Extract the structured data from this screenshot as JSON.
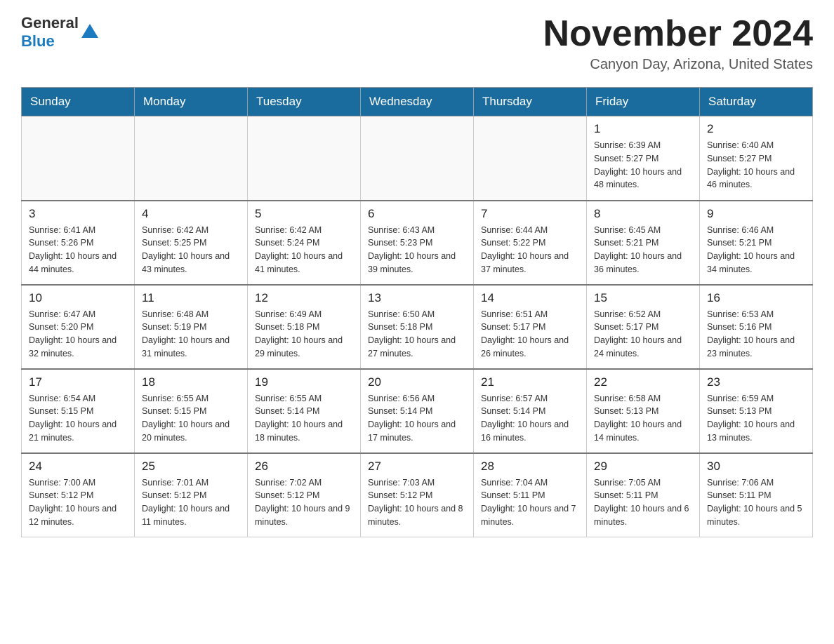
{
  "logo": {
    "text_general": "General",
    "text_blue": "Blue"
  },
  "header": {
    "title": "November 2024",
    "subtitle": "Canyon Day, Arizona, United States"
  },
  "weekdays": [
    "Sunday",
    "Monday",
    "Tuesday",
    "Wednesday",
    "Thursday",
    "Friday",
    "Saturday"
  ],
  "weeks": [
    [
      {
        "day": "",
        "info": ""
      },
      {
        "day": "",
        "info": ""
      },
      {
        "day": "",
        "info": ""
      },
      {
        "day": "",
        "info": ""
      },
      {
        "day": "",
        "info": ""
      },
      {
        "day": "1",
        "info": "Sunrise: 6:39 AM\nSunset: 5:27 PM\nDaylight: 10 hours and 48 minutes."
      },
      {
        "day": "2",
        "info": "Sunrise: 6:40 AM\nSunset: 5:27 PM\nDaylight: 10 hours and 46 minutes."
      }
    ],
    [
      {
        "day": "3",
        "info": "Sunrise: 6:41 AM\nSunset: 5:26 PM\nDaylight: 10 hours and 44 minutes."
      },
      {
        "day": "4",
        "info": "Sunrise: 6:42 AM\nSunset: 5:25 PM\nDaylight: 10 hours and 43 minutes."
      },
      {
        "day": "5",
        "info": "Sunrise: 6:42 AM\nSunset: 5:24 PM\nDaylight: 10 hours and 41 minutes."
      },
      {
        "day": "6",
        "info": "Sunrise: 6:43 AM\nSunset: 5:23 PM\nDaylight: 10 hours and 39 minutes."
      },
      {
        "day": "7",
        "info": "Sunrise: 6:44 AM\nSunset: 5:22 PM\nDaylight: 10 hours and 37 minutes."
      },
      {
        "day": "8",
        "info": "Sunrise: 6:45 AM\nSunset: 5:21 PM\nDaylight: 10 hours and 36 minutes."
      },
      {
        "day": "9",
        "info": "Sunrise: 6:46 AM\nSunset: 5:21 PM\nDaylight: 10 hours and 34 minutes."
      }
    ],
    [
      {
        "day": "10",
        "info": "Sunrise: 6:47 AM\nSunset: 5:20 PM\nDaylight: 10 hours and 32 minutes."
      },
      {
        "day": "11",
        "info": "Sunrise: 6:48 AM\nSunset: 5:19 PM\nDaylight: 10 hours and 31 minutes."
      },
      {
        "day": "12",
        "info": "Sunrise: 6:49 AM\nSunset: 5:18 PM\nDaylight: 10 hours and 29 minutes."
      },
      {
        "day": "13",
        "info": "Sunrise: 6:50 AM\nSunset: 5:18 PM\nDaylight: 10 hours and 27 minutes."
      },
      {
        "day": "14",
        "info": "Sunrise: 6:51 AM\nSunset: 5:17 PM\nDaylight: 10 hours and 26 minutes."
      },
      {
        "day": "15",
        "info": "Sunrise: 6:52 AM\nSunset: 5:17 PM\nDaylight: 10 hours and 24 minutes."
      },
      {
        "day": "16",
        "info": "Sunrise: 6:53 AM\nSunset: 5:16 PM\nDaylight: 10 hours and 23 minutes."
      }
    ],
    [
      {
        "day": "17",
        "info": "Sunrise: 6:54 AM\nSunset: 5:15 PM\nDaylight: 10 hours and 21 minutes."
      },
      {
        "day": "18",
        "info": "Sunrise: 6:55 AM\nSunset: 5:15 PM\nDaylight: 10 hours and 20 minutes."
      },
      {
        "day": "19",
        "info": "Sunrise: 6:55 AM\nSunset: 5:14 PM\nDaylight: 10 hours and 18 minutes."
      },
      {
        "day": "20",
        "info": "Sunrise: 6:56 AM\nSunset: 5:14 PM\nDaylight: 10 hours and 17 minutes."
      },
      {
        "day": "21",
        "info": "Sunrise: 6:57 AM\nSunset: 5:14 PM\nDaylight: 10 hours and 16 minutes."
      },
      {
        "day": "22",
        "info": "Sunrise: 6:58 AM\nSunset: 5:13 PM\nDaylight: 10 hours and 14 minutes."
      },
      {
        "day": "23",
        "info": "Sunrise: 6:59 AM\nSunset: 5:13 PM\nDaylight: 10 hours and 13 minutes."
      }
    ],
    [
      {
        "day": "24",
        "info": "Sunrise: 7:00 AM\nSunset: 5:12 PM\nDaylight: 10 hours and 12 minutes."
      },
      {
        "day": "25",
        "info": "Sunrise: 7:01 AM\nSunset: 5:12 PM\nDaylight: 10 hours and 11 minutes."
      },
      {
        "day": "26",
        "info": "Sunrise: 7:02 AM\nSunset: 5:12 PM\nDaylight: 10 hours and 9 minutes."
      },
      {
        "day": "27",
        "info": "Sunrise: 7:03 AM\nSunset: 5:12 PM\nDaylight: 10 hours and 8 minutes."
      },
      {
        "day": "28",
        "info": "Sunrise: 7:04 AM\nSunset: 5:11 PM\nDaylight: 10 hours and 7 minutes."
      },
      {
        "day": "29",
        "info": "Sunrise: 7:05 AM\nSunset: 5:11 PM\nDaylight: 10 hours and 6 minutes."
      },
      {
        "day": "30",
        "info": "Sunrise: 7:06 AM\nSunset: 5:11 PM\nDaylight: 10 hours and 5 minutes."
      }
    ]
  ]
}
